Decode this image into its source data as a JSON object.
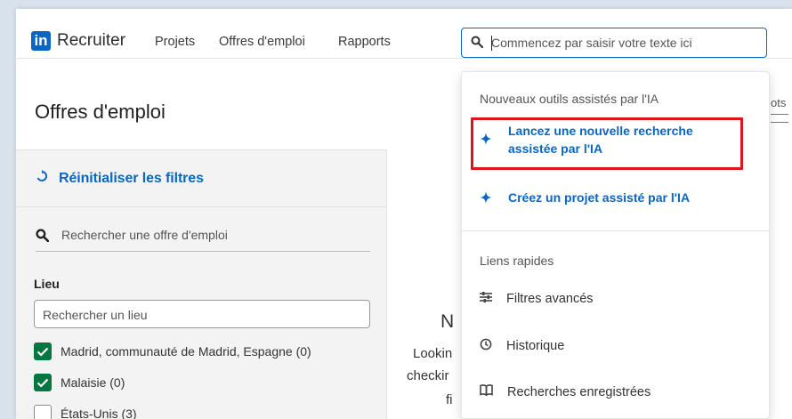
{
  "nav": {
    "logo": "in",
    "brand": "Recruiter",
    "links": [
      "Projets",
      "Offres d'emploi",
      "Rapports"
    ]
  },
  "search": {
    "placeholder": "Commencez par saisir votre texte ici"
  },
  "page": {
    "title": "Offres d'emploi",
    "right_stub": "ots"
  },
  "filters": {
    "reset_label": "Réinitialiser les filtres",
    "job_search_placeholder": "Rechercher une offre d'emploi",
    "lieu_label": "Lieu",
    "lieu_placeholder": "Rechercher un lieu",
    "locations": [
      {
        "label": "Madrid, communauté de Madrid, Espagne (0)",
        "checked": true
      },
      {
        "label": "Malaisie (0)",
        "checked": true
      },
      {
        "label": "États-Unis (3)",
        "checked": false
      }
    ]
  },
  "background_text": {
    "heading_fragment": "N",
    "line1": "Lookin",
    "line2": "checkir",
    "line3": "fi"
  },
  "dropdown": {
    "ai_heading": "Nouveaux outils assistés par l'IA",
    "ai_items": [
      {
        "line1": "Lancez une nouvelle recherche",
        "line2": "assistée par l'IA",
        "icon": "sparkle-icon"
      },
      {
        "line1": "Créez un projet assisté par l'IA",
        "icon": "sparkle-icon"
      }
    ],
    "quick_heading": "Liens rapides",
    "quick_links": [
      {
        "label": "Filtres avancés",
        "icon": "sliders-icon"
      },
      {
        "label": "Historique",
        "icon": "history-icon"
      },
      {
        "label": "Recherches enregistrées",
        "icon": "book-icon"
      }
    ]
  },
  "colors": {
    "accent": "#0a66c2",
    "checkbox": "#057642",
    "highlight": "#e0141d"
  }
}
